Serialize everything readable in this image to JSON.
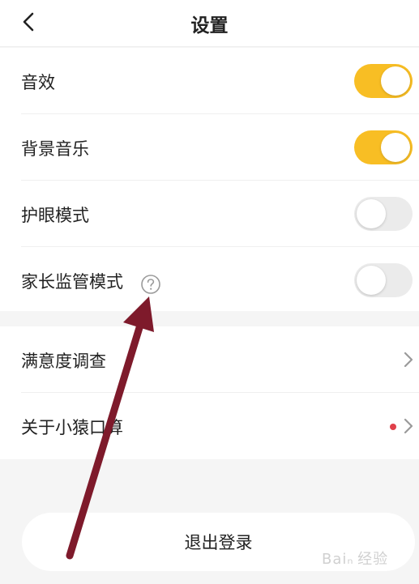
{
  "header": {
    "title": "设置",
    "back_icon": "chevron-left-icon"
  },
  "settings": {
    "sound_effects": {
      "label": "音效",
      "enabled": true
    },
    "background_music": {
      "label": "背景音乐",
      "enabled": true
    },
    "eye_protection": {
      "label": "护眼模式",
      "enabled": false
    },
    "parental_control": {
      "label": "家长监管模式",
      "enabled": false,
      "help_icon": "question-circle-icon"
    }
  },
  "links": {
    "survey": {
      "label": "满意度调查",
      "icon": "chevron-right-icon"
    },
    "about": {
      "label": "关于小猿口算",
      "badge": "red-dot",
      "icon": "chevron-right-icon"
    }
  },
  "logout": {
    "label": "退出登录"
  },
  "overlay": {
    "annotation": "red-arrow-icon",
    "watermark": "Baidu 经验"
  },
  "colors": {
    "toggle_on": "#f8be24",
    "toggle_off": "#ebebeb",
    "arrow": "#7e1a2b",
    "badge": "#e0404a",
    "page_background": "#f5f5f5"
  }
}
